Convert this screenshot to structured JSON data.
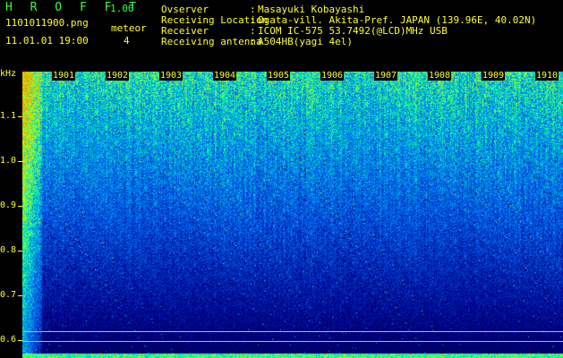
{
  "header": {
    "app_name": "H R O F F T",
    "version": "1.00",
    "filename": "1101011900.png",
    "datetime": "11.01.01 19:00",
    "meteor_label": "meteor",
    "meteor_count": "4",
    "observer_label": "Ovserver",
    "observer_value": "Masayuki Kobayashi",
    "location_label": "Receiving Location",
    "location_value": "Ogata-vill. Akita-Pref. JAPAN (139.96E, 40.02N)",
    "receiver_label": "Receiver",
    "receiver_value": "ICOM IC-575 53.7492(@LCD)MHz USB",
    "antenna_label": "Receiving antenna",
    "antenna_value": "A504HB(yagi 4el)",
    "sep": ":"
  },
  "axes": {
    "y_unit": "kHz",
    "y_ticks": [
      "1.1",
      "1.0",
      "0.9",
      "0.8",
      "0.7",
      "0.6"
    ],
    "x_ticks": [
      "1901",
      "1902",
      "1903",
      "1904",
      "1905",
      "1906",
      "1907",
      "1908",
      "1909",
      "1910"
    ]
  },
  "colors": {
    "label": "#ffff2a",
    "title": "#3cff3c",
    "background": "#000018"
  }
}
